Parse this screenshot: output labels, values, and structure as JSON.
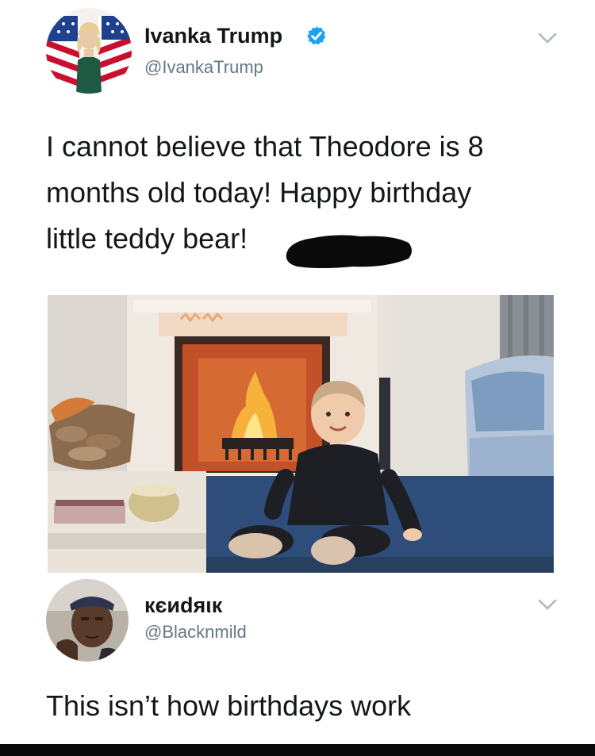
{
  "tweet": {
    "display_name": "Ivanka Trump",
    "handle": "@IvankaTrump",
    "verified_icon": "verified-badge-icon",
    "menu_icon": "chevron-down-icon",
    "text_line_1": "I cannot believe that Theodore is 8",
    "text_line_2": "months old today! Happy birthday",
    "text_line_3": "little teddy bear!",
    "photo": "photo-baby-by-fireplace"
  },
  "reply": {
    "display_name": "кєиdяιк",
    "handle": "@Blacknmild",
    "menu_icon": "chevron-down-icon",
    "text": "This isn’t how birthdays work"
  },
  "colors": {
    "text_primary": "#14171a",
    "text_secondary": "#657786",
    "verified_blue": "#1da1f2",
    "chevron": "#aab8c2"
  }
}
